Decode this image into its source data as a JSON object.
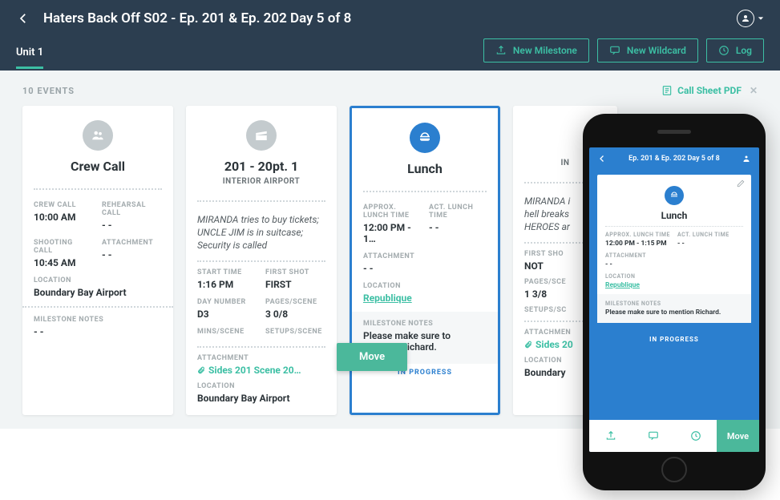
{
  "header": {
    "title": "Haters Back Off S02 - Ep. 201 & Ep. 202 Day 5 of 8",
    "tab": "Unit 1",
    "buttons": {
      "milestone": "New Milestone",
      "wildcard": "New Wildcard",
      "log": "Log"
    }
  },
  "main": {
    "events_count": "10 EVENTS",
    "call_sheet": "Call Sheet PDF"
  },
  "cards": [
    {
      "title": "Crew Call",
      "fields": {
        "crew_call_lbl": "CREW CALL",
        "crew_call": "10:00 AM",
        "rehearsal_lbl": "REHEARSAL CALL",
        "rehearsal": "- -",
        "shooting_lbl": "SHOOTING CALL",
        "shooting": "10:45 AM",
        "attach_lbl": "ATTACHMENT",
        "attach": "- -",
        "location_lbl": "LOCATION",
        "location": "Boundary Bay Airport",
        "notes_lbl": "MILESTONE NOTES",
        "notes": "- -"
      }
    },
    {
      "title": "201 - 20pt. 1",
      "subtitle": "INTERIOR AIRPORT",
      "desc": "MIRANDA tries to buy tickets; UNCLE JIM is in suitcase; Security is called",
      "fields": {
        "start_lbl": "START TIME",
        "start": "1:16 PM",
        "first_shot_lbl": "FIRST SHOT",
        "first_shot": "FIRST",
        "day_lbl": "DAY NUMBER",
        "day": "D3",
        "pages_lbl": "PAGES/SCENE",
        "pages": "3 0/8",
        "mins_lbl": "MINS/SCENE",
        "setups_lbl": "SETUPS/SCENE",
        "attach_lbl": "ATTACHMENT",
        "attach_link": "Sides 201 Scene 20…",
        "location_lbl": "LOCATION",
        "location": "Boundary Bay Airport"
      }
    },
    {
      "title": "Lunch",
      "fields": {
        "approx_lbl": "APPROX. LUNCH TIME",
        "approx": "12:00 PM - 1…",
        "act_lbl": "ACT. LUNCH TIME",
        "act": "- -",
        "attach_lbl": "ATTACHMENT",
        "attach": "- -",
        "location_lbl": "LOCATION",
        "location_link": "Republique",
        "notes_lbl": "MILESTONE NOTES",
        "notes": "Please make sure to mention Richard."
      },
      "status": "IN PROGRESS"
    },
    {
      "subtitle_prefix": "IN",
      "desc": "MIRANDA i\nhell breaks\nHEROES ar",
      "fields": {
        "first_shot_lbl": "FIRST SHO",
        "first_shot": "NOT",
        "pages_lbl": "PAGES/SCE",
        "pages": "1 3/8",
        "setups_lbl": "SETUPS/SC",
        "attach_lbl": "ATTACHMEN",
        "attach_link": "Sides 20",
        "location_lbl": "LOCATION",
        "location": "Boundary"
      }
    }
  ],
  "move_button": "Move",
  "phone": {
    "header_title": "Ep. 201 & Ep. 202 Day 5 of 8",
    "card": {
      "title": "Lunch",
      "approx_lbl": "APPROX. LUNCH TIME",
      "approx": "12:00 PM - 1:15 PM",
      "act_lbl": "ACT. LUNCH TIME",
      "act": "- -",
      "attach_lbl": "ATTACHMENT",
      "attach": "- -",
      "location_lbl": "LOCATION",
      "location_link": "Republique",
      "notes_lbl": "MILESTONE NOTES",
      "notes": "Please make sure to mention Richard."
    },
    "status": "IN PROGRESS",
    "move": "Move"
  }
}
